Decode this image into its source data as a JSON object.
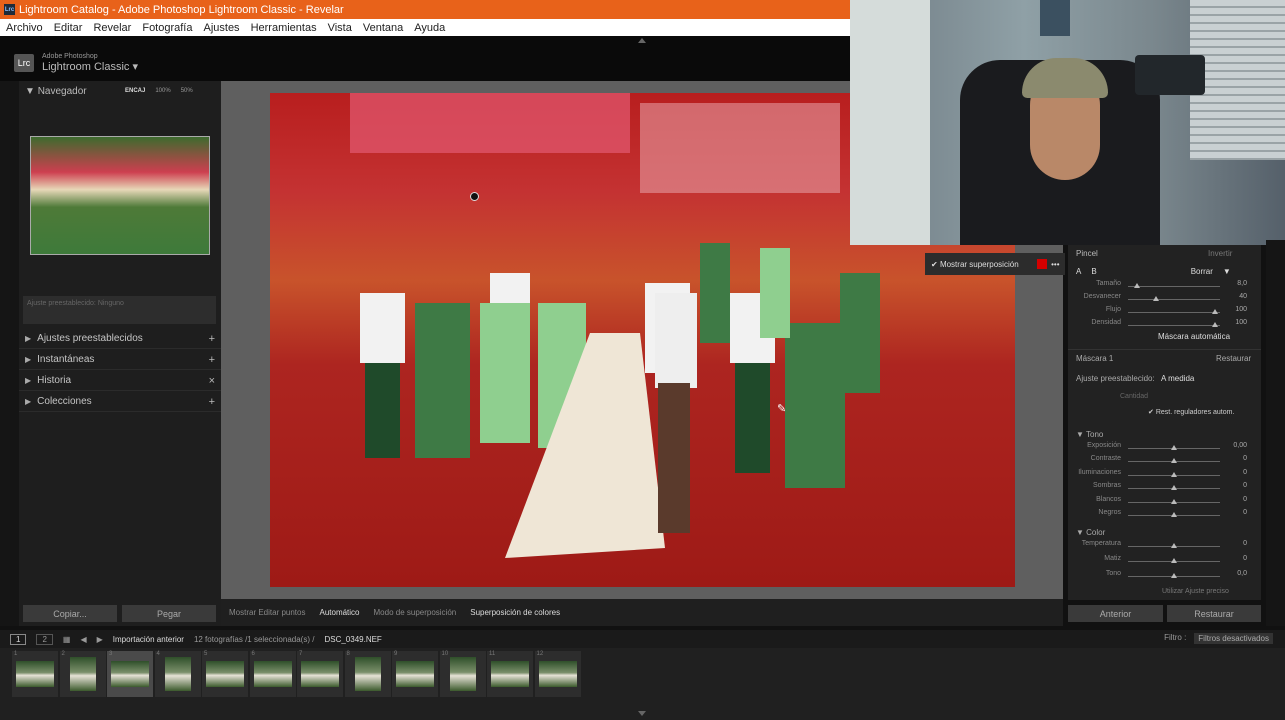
{
  "window": {
    "title": "Lightroom Catalog - Adobe Photoshop Lightroom Classic - Revelar",
    "lrc": "Lrc"
  },
  "menu": [
    "Archivo",
    "Editar",
    "Revelar",
    "Fotografía",
    "Ajustes",
    "Herramientas",
    "Vista",
    "Ventana",
    "Ayuda"
  ],
  "brand": {
    "small": "Adobe Photoshop",
    "name": "Lightroom Classic"
  },
  "navigator": {
    "title": "Navegador",
    "zoom": [
      "ENCAJ",
      "100%",
      "50%"
    ]
  },
  "left_preset": "Ajuste preestablecido: Ninguno",
  "left_panels": [
    {
      "label": "Ajustes preestablecidos",
      "action": "+"
    },
    {
      "label": "Instantáneas",
      "action": "+"
    },
    {
      "label": "Historia",
      "action": "×"
    },
    {
      "label": "Colecciones",
      "action": "+"
    }
  ],
  "buttons": {
    "copy": "Copiar...",
    "paste": "Pegar",
    "prev": "Anterior",
    "reset": "Restaurar"
  },
  "toolbar": {
    "show_edit_points": "Mostrar Editar puntos",
    "auto": "Automático",
    "overlay_mode": "Modo de superposición",
    "color_overlay": "Superposición de colores"
  },
  "overlay": {
    "show_label": "Mostrar superposición",
    "color": "#d40000"
  },
  "brush": {
    "title": "Pincel",
    "invert": "Invertir",
    "a": "A",
    "b": "B",
    "erase": "Borrar",
    "rows": [
      {
        "label": "Tamaño",
        "value": "8,0",
        "pos": 0.1
      },
      {
        "label": "Desvanecer",
        "value": "40",
        "pos": 0.3
      },
      {
        "label": "Flujo",
        "value": "100",
        "pos": 0.95
      },
      {
        "label": "Densidad",
        "value": "100",
        "pos": 0.95
      }
    ],
    "automask": "Máscara automática"
  },
  "mask": {
    "title": "Máscara 1",
    "restore": "Restaurar",
    "preset_label": "Ajuste preestablecido:",
    "preset_value": "A medida",
    "amount": "Cantidad",
    "auto_reset": "Rest. reguladores autom."
  },
  "tone": {
    "title": "Tono",
    "rows": [
      {
        "label": "Exposición",
        "value": "0,00"
      },
      {
        "label": "Contraste",
        "value": "0"
      },
      {
        "label": "Iluminaciones",
        "value": "0"
      },
      {
        "label": "Sombras",
        "value": "0"
      },
      {
        "label": "Blancos",
        "value": "0"
      },
      {
        "label": "Negros",
        "value": "0"
      }
    ]
  },
  "color": {
    "title": "Color",
    "rows": [
      {
        "label": "Temperatura",
        "value": "0"
      },
      {
        "label": "Matiz",
        "value": "0"
      },
      {
        "label": "Tono",
        "value": "0,0"
      }
    ],
    "precise": "Utilizar Ajuste preciso"
  },
  "filmbar": {
    "view1": "1",
    "view2": "2",
    "source": "Importación anterior",
    "count": "12 fotografías /1 seleccionada(s) /",
    "file": "DSC_0349.NEF",
    "filter_label": "Filtro :",
    "filter_value": "Filtros desactivados"
  },
  "filmstrip": {
    "numbers": [
      "1",
      "2",
      "3",
      "4",
      "5",
      "6",
      "7",
      "8",
      "9",
      "10",
      "11",
      "12"
    ],
    "selected": 3
  }
}
